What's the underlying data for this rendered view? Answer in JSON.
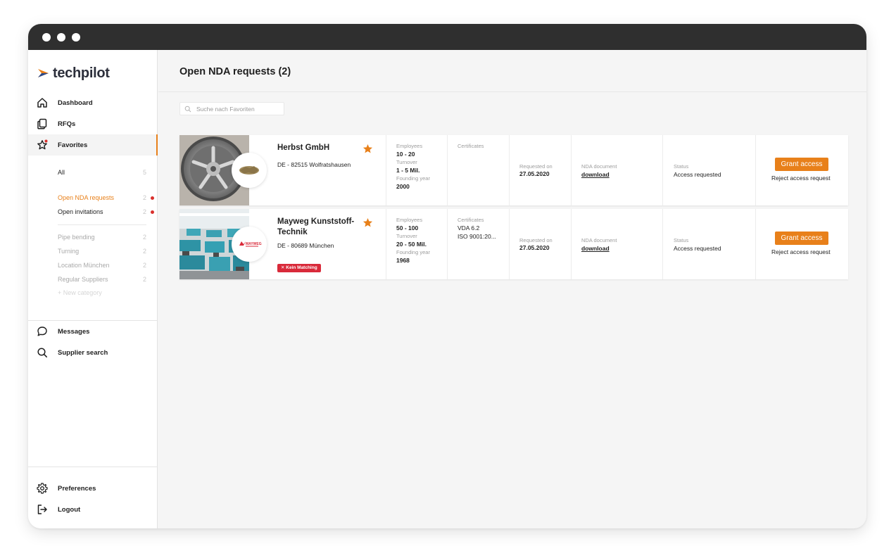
{
  "app": {
    "brand": "techpilot"
  },
  "sidebar": {
    "nav": [
      {
        "label": "Dashboard",
        "icon": "home-icon"
      },
      {
        "label": "RFQs",
        "icon": "documents-icon"
      },
      {
        "label": "Favorites",
        "icon": "star-icon"
      }
    ],
    "favorites_sub": [
      {
        "label": "All",
        "count": "5"
      },
      {
        "label": "Open NDA requests",
        "count": "2"
      },
      {
        "label": "Open invitations",
        "count": "2"
      },
      {
        "label": "Pipe bending",
        "count": "2"
      },
      {
        "label": "Turning",
        "count": "2"
      },
      {
        "label": "Location München",
        "count": "2"
      },
      {
        "label": "Regular Suppliers",
        "count": "2"
      },
      {
        "label": "+ New category"
      }
    ],
    "nav_bottom": [
      {
        "label": "Messages",
        "icon": "chat-bubble-icon"
      },
      {
        "label": "Supplier search",
        "icon": "search-icon"
      }
    ],
    "footer": [
      {
        "label": "Preferences",
        "icon": "gear-icon"
      },
      {
        "label": "Logout",
        "icon": "logout-icon"
      }
    ]
  },
  "main": {
    "title": "Open NDA requests (2)",
    "search_placeholder": "Suche nach Favoriten"
  },
  "labels": {
    "employees": "Employees",
    "turnover": "Turnover",
    "founding_year": "Founding year",
    "certificates": "Certificates",
    "requested_on": "Requested on",
    "nda_document": "NDA document",
    "status": "Status",
    "grant_access": "Grant access",
    "reject_access": "Reject access request",
    "download": "download"
  },
  "suppliers": [
    {
      "name": "Herbst GmbH",
      "location": "DE - 82515 Wolfratshausen",
      "employees": "10 - 20",
      "turnover": "1 - 5 Mil.",
      "founding_year": "2000",
      "certificates": [],
      "requested_on": "27.05.2020",
      "status": "Access requested",
      "favorite": true
    },
    {
      "name": "Mayweg Kunststoff-Technik",
      "name_line1": "Mayweg Kunststoff-",
      "name_line2": "Technik",
      "location": "DE - 80689 München",
      "employees": "50 - 100",
      "turnover": "20 - 50 Mil.",
      "founding_year": "1968",
      "certificates": [
        "VDA 6.2",
        "ISO 9001:20..."
      ],
      "requested_on": "27.05.2020",
      "status": "Access requested",
      "favorite": true,
      "badge": "Kein Matching",
      "logo_text": "MAYWEG"
    }
  ],
  "colors": {
    "accent": "#e8801a",
    "titlebar": "#2f2f2f",
    "badge_red": "#d92a3a",
    "notification_dot": "#d9302c"
  }
}
